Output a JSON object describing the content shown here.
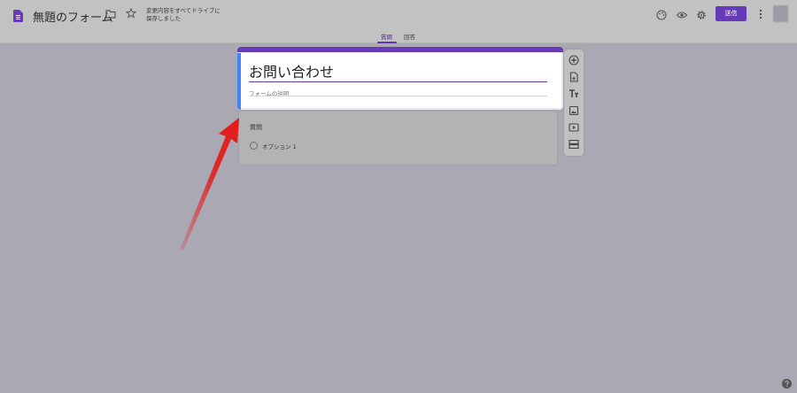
{
  "header": {
    "doc_title": "無題のフォーム",
    "save_status": "変更内容をすべてドライブに保存しました",
    "send_label": "送信",
    "icons": [
      "forms-icon",
      "folder-icon",
      "star-icon",
      "palette-icon",
      "preview-eye-icon",
      "settings-gear-icon",
      "more-vert-icon"
    ]
  },
  "tabs": [
    {
      "label": "質問",
      "active": true
    },
    {
      "label": "回答",
      "active": false
    }
  ],
  "form": {
    "title": "お問い合わせ",
    "description_placeholder": "フォームの説明"
  },
  "question": {
    "label": "質問",
    "option_label": "オプション 1"
  },
  "toolbar": {
    "tools": [
      "add-question-icon",
      "import-questions-icon",
      "add-title-icon",
      "add-image-icon",
      "add-video-icon",
      "add-section-icon"
    ]
  },
  "colors": {
    "accent": "#673ab7",
    "title_left_bar": "#4285f4",
    "overlay": "#aaa8b2",
    "arrow": "#e31a1a"
  }
}
